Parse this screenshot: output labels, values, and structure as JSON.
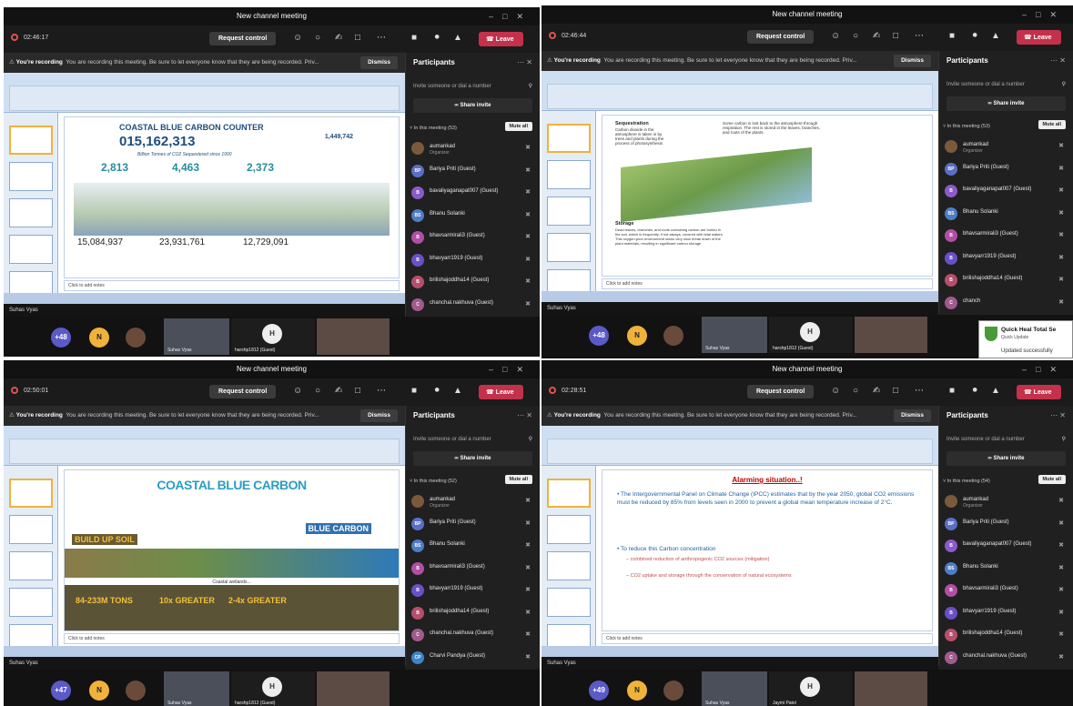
{
  "panels": [
    {
      "title": "New channel meeting",
      "timer": "02:46:17",
      "request_control": "Request control",
      "leave": "Leave",
      "recording_bold": "You're recording",
      "recording_text": "You are recording this meeting. Be sure to let everyone know that they are being recorded. Priv...",
      "dismiss": "Dismiss",
      "participants_title": "Participants",
      "invite_placeholder": "Invite someone or dial a number",
      "share_invite": "Share invite",
      "in_meeting": "In this meeting (53)",
      "mute_all": "Mute all",
      "presenter": "Suhas Vyas",
      "notes": "Click to add notes",
      "overflow_count": "+48",
      "guest_tile": "harshp1812 (Guest)",
      "speaker_tile": "Suhas Vyas",
      "slide": {
        "heading": "COASTAL BLUE CARBON COUNTER",
        "counter": "015,162,313",
        "sub": "Billion Tonnes of CO2 Sequestered since 1990",
        "values": [
          "2,813",
          "4,463",
          "2,373"
        ],
        "totals": [
          "15,084,937",
          "23,931,761",
          "12,729,091"
        ],
        "side": "1,449,742"
      },
      "participants": [
        {
          "name": "aumankad",
          "sub": "Organizer",
          "initials": "",
          "color": "#7a5a3a"
        },
        {
          "name": "Bariya Priti (Guest)",
          "initials": "BP",
          "color": "#5b6ec5"
        },
        {
          "name": "bavaliyaganapat007 (Guest)",
          "initials": "B",
          "color": "#8c5ac8"
        },
        {
          "name": "Bhanu Solanki",
          "initials": "BS",
          "color": "#4f7cc7"
        },
        {
          "name": "bhavsarmirali3 (Guest)",
          "initials": "B",
          "color": "#b04fa3"
        },
        {
          "name": "bhavyarr1919 (Guest)",
          "initials": "B",
          "color": "#6a4fc7"
        },
        {
          "name": "brilishajoddha14 (Guest)",
          "initials": "B",
          "color": "#b54f6d"
        },
        {
          "name": "chanchal.nakhuva (Guest)",
          "initials": "C",
          "color": "#a05a8c"
        },
        {
          "name": "Charvi Pandya (Guest)",
          "initials": "CP",
          "color": "#3d84c7"
        }
      ]
    },
    {
      "title": "New channel meeting",
      "timer": "02:46:44",
      "request_control": "Request control",
      "leave": "Leave",
      "tooltip": "Unmute (Ctrl+Shift+M)",
      "recording_bold": "You're recording",
      "recording_text": "You are recording this meeting. Be sure to let everyone know that they are being recorded. Priv...",
      "dismiss": "Dismiss",
      "participants_title": "Participants",
      "invite_placeholder": "Invite someone or dial a number",
      "share_invite": "Share invite",
      "in_meeting": "In this meeting (53)",
      "mute_all": "Mute all",
      "presenter": "Suhas Vyas",
      "notes": "Click to add notes",
      "overflow_count": "+48",
      "guest_tile": "harshp1812 (Guest)",
      "toast_title": "Quick Heal Total Se",
      "toast_sub": "Quick Update",
      "toast_status": "Updated successfully",
      "slide": {
        "seq_title": "Sequestration",
        "seq_text": "Carbon dioxide in the atmosphere is taken in by trees and plants during the process of photosynthesis",
        "resp_text": "Some carbon is lost back to the atmosphere through respiration. The rest is stored in the leaves, branches, and roots of the plants.",
        "storage_title": "Storage",
        "storage_text": "Dead leaves, branches, and roots containing carbon are buried in the soil, which is frequently, if not always, covered with tidal waters. This oxygen-poor environment slows very slow break down of the plant materials, resulting in significant carbon storage"
      },
      "participants": [
        {
          "name": "aumankad",
          "sub": "Organizer",
          "initials": "",
          "color": "#7a5a3a"
        },
        {
          "name": "Bariya Priti (Guest)",
          "initials": "BP",
          "color": "#5b6ec5"
        },
        {
          "name": "bavaliyaganapat007 (Guest)",
          "initials": "B",
          "color": "#8c5ac8"
        },
        {
          "name": "Bhanu Solanki",
          "initials": "BS",
          "color": "#4f7cc7"
        },
        {
          "name": "bhavsarmirali3 (Guest)",
          "initials": "B",
          "color": "#b04fa3"
        },
        {
          "name": "bhavyarr1919 (Guest)",
          "initials": "B",
          "color": "#6a4fc7"
        },
        {
          "name": "brilishajoddha14 (Guest)",
          "initials": "B",
          "color": "#b54f6d"
        },
        {
          "name": "chanch",
          "initials": "C",
          "color": "#a05a8c"
        },
        {
          "name": "Charvi",
          "initials": "CP",
          "color": "#3d84c7"
        }
      ]
    },
    {
      "title": "New channel meeting",
      "timer": "02:50:01",
      "request_control": "Request control",
      "leave": "Leave",
      "recording_bold": "You're recording",
      "recording_text": "You are recording this meeting. Be sure to let everyone know that they are being recorded. Priv...",
      "dismiss": "Dismiss",
      "participants_title": "Participants",
      "invite_placeholder": "Invite someone or dial a number",
      "share_invite": "Share invite",
      "in_meeting": "In this meeting (52)",
      "mute_all": "Mute all",
      "presenter": "Suhas Vyas",
      "notes": "Click to add notes",
      "overflow_count": "+47",
      "guest_tile": "harshp1812 (Guest)",
      "slide": {
        "heading": "COASTAL BLUE CARBON",
        "left_label": "BUILD UP SOIL",
        "right_label": "BLUE CARBON",
        "stat1": "84-233M TONS",
        "stat2": "10x GREATER",
        "stat3": "2-4x GREATER",
        "middle_caption": "Coastal wetlands..."
      },
      "participants": [
        {
          "name": "aumankad",
          "sub": "Organizer",
          "initials": "",
          "color": "#7a5a3a"
        },
        {
          "name": "Bariya Priti (Guest)",
          "initials": "BP",
          "color": "#5b6ec5"
        },
        {
          "name": "Bhanu Solanki",
          "initials": "BS",
          "color": "#4f7cc7"
        },
        {
          "name": "bhavsarmirali3 (Guest)",
          "initials": "B",
          "color": "#b04fa3"
        },
        {
          "name": "bhavyarr1919 (Guest)",
          "initials": "B",
          "color": "#6a4fc7"
        },
        {
          "name": "brilishajoddha14 (Guest)",
          "initials": "B",
          "color": "#b54f6d"
        },
        {
          "name": "chanchal.nakhuva (Guest)",
          "initials": "C",
          "color": "#a05a8c"
        },
        {
          "name": "Charvi Pandya (Guest)",
          "initials": "CP",
          "color": "#3d84c7"
        },
        {
          "name": "chaudharyvanshi42 (Guest)",
          "initials": "C",
          "color": "#8a5ac0"
        }
      ]
    },
    {
      "title": "New channel meeting",
      "timer": "02:28:51",
      "request_control": "Request control",
      "leave": "Leave",
      "recording_bold": "You're recording",
      "recording_text": "You are recording this meeting. Be sure to let everyone know that they are being recorded. Priv...",
      "dismiss": "Dismiss",
      "participants_title": "Participants",
      "invite_placeholder": "Invite someone or dial a number",
      "share_invite": "Share invite",
      "in_meeting": "In this meeting (54)",
      "mute_all": "Mute all",
      "presenter": "Suhas Vyas",
      "notes": "Click to add notes",
      "overflow_count": "+49",
      "guest_tile": "Jaymi Patel",
      "slide": {
        "heading": "Alarming situation..!",
        "bullet1": "The Intergovernmental Panel on Climate Change (IPCC) estimates that by the year 2050, global CO2 emissions must be reduced by 85% from levels seen in 2000 to prevent a global mean temperature increase of 2°C.",
        "bullet2": "To reduce this Carbon concentration",
        "sub1": "combined reduction of anthropogenic CO2 sources (mitigation)",
        "sub2": "CO2 uptake and storage through the conservation of natural ecosystems"
      },
      "participants": [
        {
          "name": "aumankad",
          "sub": "Organizer",
          "initials": "",
          "color": "#7a5a3a"
        },
        {
          "name": "Bariya Priti (Guest)",
          "initials": "BP",
          "color": "#5b6ec5"
        },
        {
          "name": "bavaliyaganapat007 (Guest)",
          "initials": "B",
          "color": "#8c5ac8"
        },
        {
          "name": "Bhanu Solanki",
          "initials": "BS",
          "color": "#4f7cc7"
        },
        {
          "name": "bhavsarmirali3 (Guest)",
          "initials": "B",
          "color": "#b04fa3"
        },
        {
          "name": "bhavyarr1919 (Guest)",
          "initials": "B",
          "color": "#6a4fc7"
        },
        {
          "name": "brilishajoddha14 (Guest)",
          "initials": "B",
          "color": "#b54f6d"
        },
        {
          "name": "chanchal.nakhuva (Guest)",
          "initials": "C",
          "color": "#a05a8c"
        },
        {
          "name": "Charvi Pandya (Guest)",
          "initials": "CP",
          "color": "#3d84c7"
        }
      ]
    }
  ],
  "colors": {
    "leave": "#c4314b",
    "record": "#e0524f",
    "panel_bg": "#202020",
    "accent": "#6264a7"
  },
  "icons": [
    "record-icon",
    "people-icon",
    "chat-icon",
    "reactions-icon",
    "share-tray-icon",
    "more-icon",
    "camera-icon",
    "mic-off-icon",
    "share-icon",
    "phone-icon",
    "search-icon",
    "close-icon",
    "mic-muted-icon",
    "warning-icon",
    "link-icon"
  ]
}
